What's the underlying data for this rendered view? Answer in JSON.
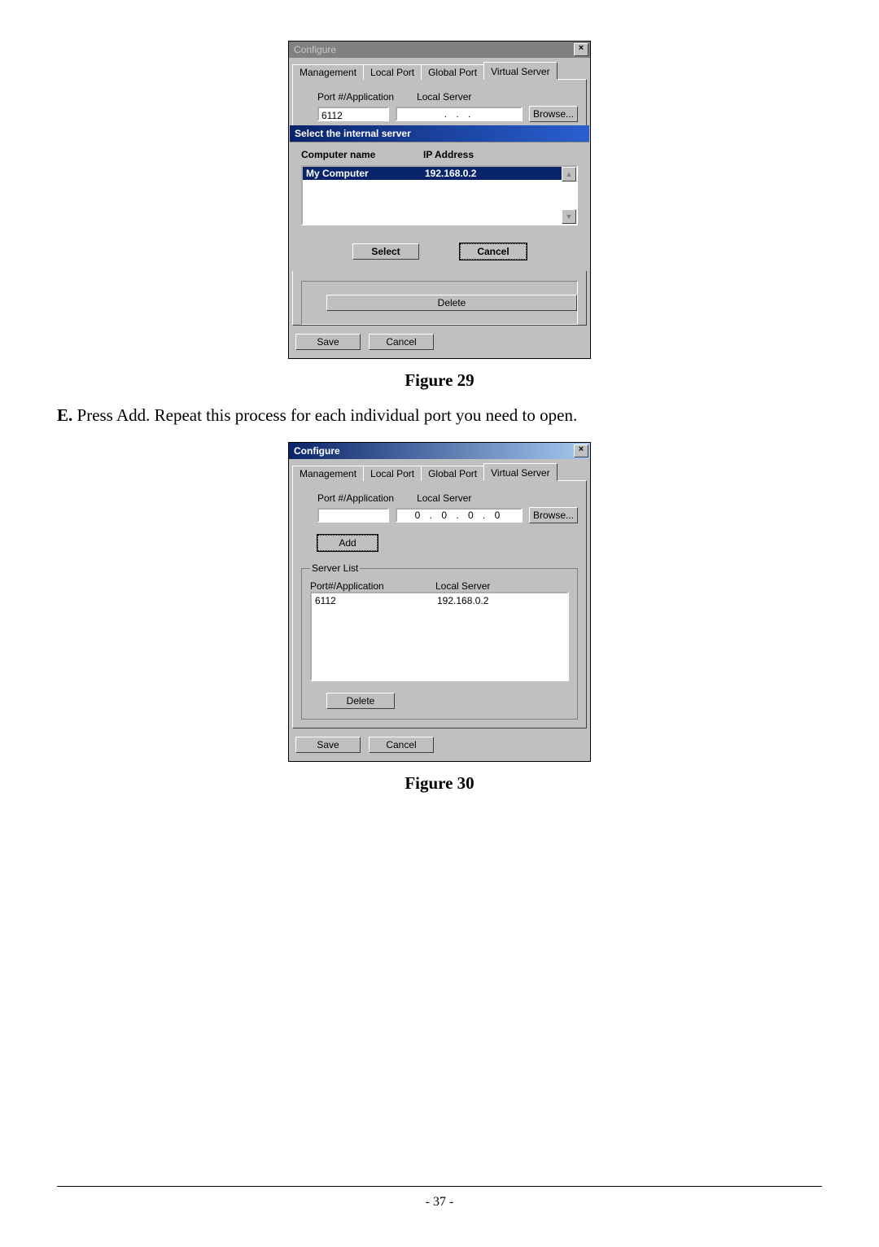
{
  "fig1": {
    "title": "Configure",
    "tabs": [
      "Management",
      "Local Port",
      "Global Port",
      "Virtual Server"
    ],
    "active_tab": 3,
    "port_label": "Port #/Application",
    "local_server_label": "Local Server",
    "port_value": "6112",
    "ip_display": ".     .     .",
    "browse_label": "Browse...",
    "popup_title": "Select the internal server",
    "col_computer": "Computer name",
    "col_ip": "IP Address",
    "selected_computer": "My Computer",
    "selected_ip": "192.168.0.2",
    "select_label": "Select",
    "cancel_label": "Cancel",
    "delete_label": "Delete",
    "save_label": "Save",
    "bottom_cancel_label": "Cancel"
  },
  "caption1": "Figure 29",
  "instruction": {
    "step": "E.",
    "text": " Press Add. Repeat this process for each individual port you need to open."
  },
  "fig2": {
    "title": "Configure",
    "tabs": [
      "Management",
      "Local Port",
      "Global Port",
      "Virtual Server"
    ],
    "active_tab": 3,
    "port_label": "Port #/Application",
    "local_server_label": "Local Server",
    "port_value": "",
    "ip_display": "0  .  0  .  0  .  0",
    "browse_label": "Browse...",
    "add_label": "Add",
    "serverlist_legend": "Server List",
    "col_port": "Port#/Application",
    "col_local": "Local Server",
    "entries": [
      {
        "port": "6112",
        "server": "192.168.0.2"
      }
    ],
    "delete_label": "Delete",
    "save_label": "Save",
    "bottom_cancel_label": "Cancel"
  },
  "caption2": "Figure 30",
  "page_number": "- 37 -"
}
